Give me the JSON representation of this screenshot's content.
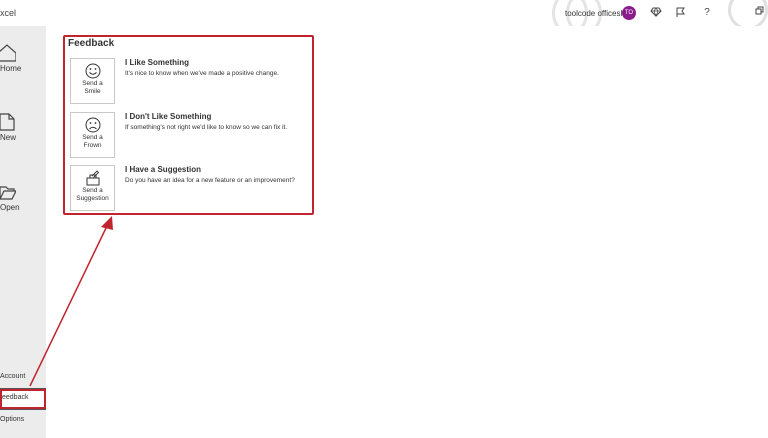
{
  "titlebar": {
    "app_title": "xcel",
    "user_name": "toolcode officeshop",
    "user_initials": "TO"
  },
  "nav": {
    "items": [
      {
        "label": "Home",
        "icon": "home-icon"
      },
      {
        "label": "New",
        "icon": "new-document-icon"
      },
      {
        "label": "Open",
        "icon": "folder-open-icon"
      }
    ],
    "bottom": {
      "account": "Account",
      "feedback": "eedback",
      "options": "Options"
    }
  },
  "feedback": {
    "heading": "Feedback",
    "options": [
      {
        "card_line1": "Send a",
        "card_line2": "Smile",
        "title": "I Like Something",
        "desc": "It's nice to know when we've made a positive change.",
        "icon": "smile-icon"
      },
      {
        "card_line1": "Send a",
        "card_line2": "Frown",
        "title": "I Don't Like Something",
        "desc": "If something's not right we'd like to know so we can fix it.",
        "icon": "frown-icon"
      },
      {
        "card_line1": "Send a",
        "card_line2": "Suggestion",
        "title": "I Have a Suggestion",
        "desc": "Do you have an idea for a new feature or an improvement?",
        "icon": "suggestion-icon"
      }
    ]
  },
  "colors": {
    "highlight": "#c0242c",
    "avatar": "#8b1c8b"
  }
}
